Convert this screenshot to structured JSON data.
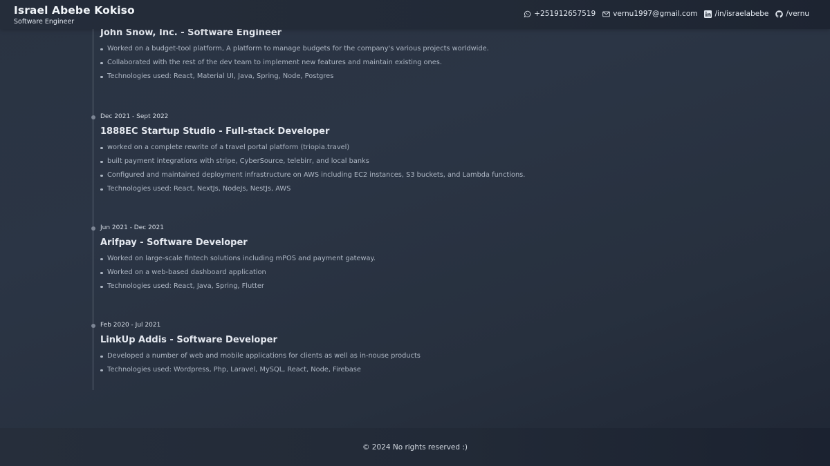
{
  "header": {
    "name": "Israel Abebe Kokiso",
    "title": "Software Engineer",
    "contacts": {
      "phone": "+251912657519",
      "email": "vernu1997@gmail.com",
      "linkedin": "/in/israelabebe",
      "github": "/vernu"
    }
  },
  "experience": [
    {
      "date": "",
      "role": "John Snow, Inc. - Software Engineer",
      "bullets": [
        "Worked on a budget-tool platform, A platform to manage budgets for the company's various projects worldwide.",
        "Collaborated with the rest of the dev team to implement new features and maintain existing ones.",
        "Technologies used: React, Material UI, Java, Spring, Node, Postgres"
      ]
    },
    {
      "date": "Dec 2021 - Sept 2022",
      "role": "1888EC Startup Studio - Full-stack Developer",
      "bullets": [
        "worked on a complete rewrite of a travel portal platform (triopia.travel)",
        "built payment integrations with stripe, CyberSource, telebirr, and local banks",
        "Configured and maintained deployment infrastructure on AWS including EC2 instances, S3 buckets, and Lambda functions.",
        "Technologies used: React, NextJs, NodeJs, NestJs, AWS"
      ]
    },
    {
      "date": "Jun 2021 - Dec 2021",
      "role": "Arifpay - Software Developer",
      "bullets": [
        "Worked on large-scale fintech solutions including mPOS and payment gateway.",
        "Worked on a web-based dashboard application",
        "Technologies used: React, Java, Spring, Flutter"
      ]
    },
    {
      "date": "Feb 2020 - Jul 2021",
      "role": "LinkUp Addis - Software Developer",
      "bullets": [
        "Developed a number of web and mobile applications for clients as well as in-nouse products",
        "Technologies used: Wordpress, Php, Laravel, MySQL, React, Node, Firebase"
      ]
    }
  ],
  "footer": {
    "text": "© 2024 No rights reserved :)"
  },
  "icons": {
    "phone": "whatsapp-icon",
    "email": "mail-icon",
    "linkedin": "linkedin-icon",
    "github": "github-icon"
  }
}
